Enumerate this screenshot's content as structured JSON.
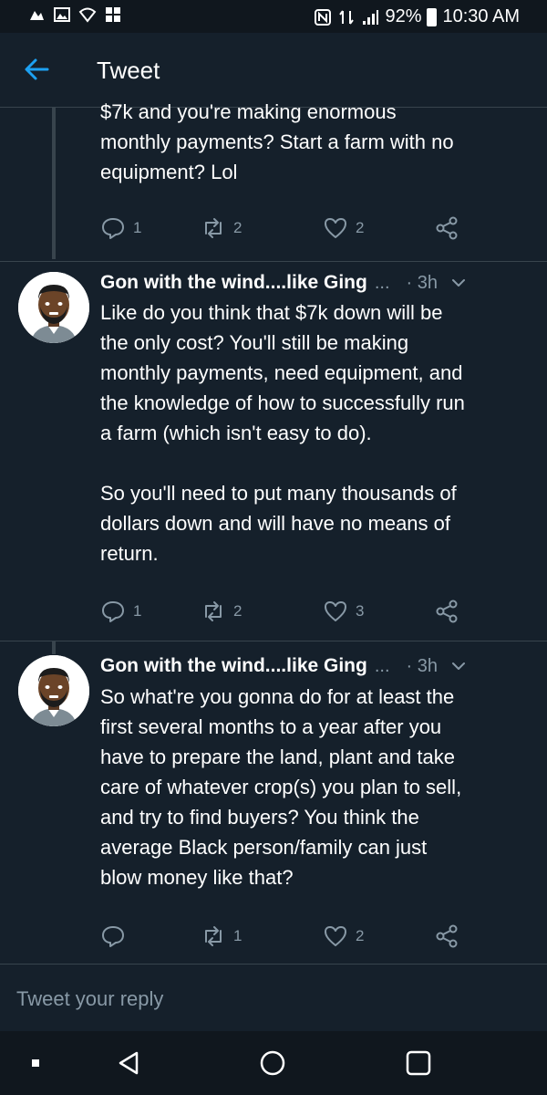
{
  "status_bar": {
    "battery": "92%",
    "time": "10:30 AM",
    "left_icons": [
      "notification-icon",
      "gallery-icon",
      "wifi-icon",
      "grid-icon"
    ],
    "right_icons": [
      "nfc-icon",
      "data-icon",
      "signal-icon",
      "battery-icon"
    ]
  },
  "header": {
    "title": "Tweet",
    "back_icon": "back-arrow-icon"
  },
  "tweets": [
    {
      "text": "$7k and you're making enormous\nmonthly payments? Start a farm with no\nequipment? Lol",
      "replies": "1",
      "retweets": "2",
      "likes": "2"
    },
    {
      "author": "Gon with the wind....like Ging",
      "ellipsis": "...",
      "time": "· 3h",
      "text": "Like do you think that $7k down will be\nthe only cost? You'll still be making\nmonthly payments, need equipment, and\nthe knowledge of how to successfully run\na farm (which isn't easy to do).\n\nSo you'll need to put many thousands of\ndollars down and will have no means of\nreturn.",
      "replies": "1",
      "retweets": "2",
      "likes": "3"
    },
    {
      "author": "Gon with the wind....like Ging",
      "ellipsis": "...",
      "time": "· 3h",
      "text": "So what're you gonna do for at least the\nfirst several months  to a year after you\nhave to prepare the land, plant and take\ncare of whatever crop(s) you plan to sell,\nand try to find buyers? You think the\naverage Black person/family can just\nblow money like that?",
      "replies": "",
      "retweets": "1",
      "likes": "2"
    }
  ],
  "reply": {
    "placeholder": "Tweet your reply"
  },
  "nav": {
    "buttons": [
      "recents-dot-icon",
      "back-triangle-icon",
      "home-circle-icon",
      "overview-square-icon"
    ]
  },
  "colors": {
    "background": "#15202b",
    "accent": "#1da1f2",
    "muted": "#8899a6",
    "divider": "#38444d"
  }
}
